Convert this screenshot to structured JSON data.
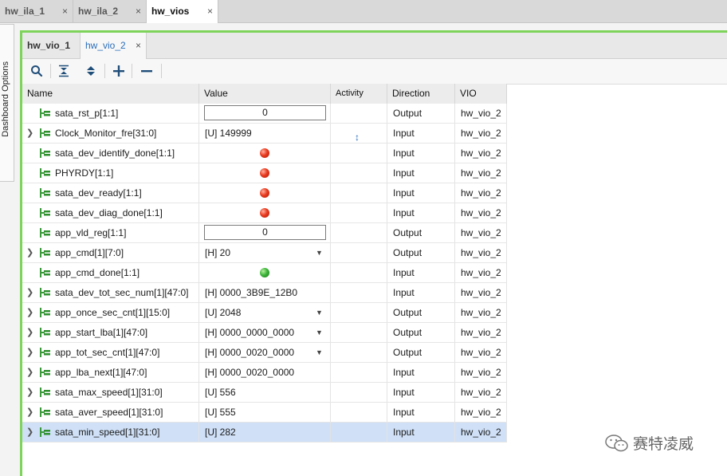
{
  "top_tabs": [
    {
      "label": "hw_ila_1",
      "close": "×",
      "active": false
    },
    {
      "label": "hw_ila_2",
      "close": "×",
      "active": false
    },
    {
      "label": "hw_vios",
      "close": "×",
      "active": true
    }
  ],
  "side_panel": {
    "label": "Dashboard Options"
  },
  "sub_tabs": [
    {
      "label": "hw_vio_1",
      "active": false
    },
    {
      "label": "hw_vio_2",
      "close": "×",
      "active": true
    }
  ],
  "toolbar": {
    "icons": [
      "search-icon",
      "collapse-all-icon",
      "expand-all-icon",
      "add-icon",
      "remove-icon"
    ]
  },
  "columns": [
    "Name",
    "Value",
    "Activity",
    "Direction",
    "VIO"
  ],
  "rows": [
    {
      "name": "sata_rst_p[1:1]",
      "expandable": false,
      "value_type": "text",
      "value": "0",
      "activity": "",
      "direction": "Output",
      "vio": "hw_vio_2"
    },
    {
      "name": "Clock_Monitor_fre[31:0]",
      "expandable": true,
      "value_type": "plain",
      "value": "[U] 149999",
      "activity": "↕",
      "direction": "Input",
      "vio": "hw_vio_2"
    },
    {
      "name": "sata_dev_identify_done[1:1]",
      "expandable": false,
      "value_type": "led",
      "led": "red",
      "activity": "",
      "direction": "Input",
      "vio": "hw_vio_2"
    },
    {
      "name": "PHYRDY[1:1]",
      "expandable": false,
      "value_type": "led",
      "led": "red",
      "activity": "",
      "direction": "Input",
      "vio": "hw_vio_2"
    },
    {
      "name": "sata_dev_ready[1:1]",
      "expandable": false,
      "value_type": "led",
      "led": "red",
      "activity": "",
      "direction": "Input",
      "vio": "hw_vio_2"
    },
    {
      "name": "sata_dev_diag_done[1:1]",
      "expandable": false,
      "value_type": "led",
      "led": "red",
      "activity": "",
      "direction": "Input",
      "vio": "hw_vio_2"
    },
    {
      "name": "app_vld_reg[1:1]",
      "expandable": false,
      "value_type": "text",
      "value": "0",
      "activity": "",
      "direction": "Output",
      "vio": "hw_vio_2"
    },
    {
      "name": "app_cmd[1][7:0]",
      "expandable": true,
      "value_type": "dropdown",
      "value": "[H] 20",
      "activity": "",
      "direction": "Output",
      "vio": "hw_vio_2"
    },
    {
      "name": "app_cmd_done[1:1]",
      "expandable": false,
      "value_type": "led",
      "led": "green",
      "activity": "",
      "direction": "Input",
      "vio": "hw_vio_2"
    },
    {
      "name": "sata_dev_tot_sec_num[1][47:0]",
      "expandable": true,
      "value_type": "plain",
      "value": "[H] 0000_3B9E_12B0",
      "activity": "",
      "direction": "Input",
      "vio": "hw_vio_2"
    },
    {
      "name": "app_once_sec_cnt[1][15:0]",
      "expandable": true,
      "value_type": "dropdown",
      "value": "[U] 2048",
      "activity": "",
      "direction": "Output",
      "vio": "hw_vio_2"
    },
    {
      "name": "app_start_lba[1][47:0]",
      "expandable": true,
      "value_type": "dropdown",
      "value": "[H] 0000_0000_0000",
      "activity": "",
      "direction": "Output",
      "vio": "hw_vio_2"
    },
    {
      "name": "app_tot_sec_cnt[1][47:0]",
      "expandable": true,
      "value_type": "dropdown",
      "value": "[H] 0000_0020_0000",
      "activity": "",
      "direction": "Output",
      "vio": "hw_vio_2"
    },
    {
      "name": "app_lba_next[1][47:0]",
      "expandable": true,
      "value_type": "plain",
      "value": "[H] 0000_0020_0000",
      "activity": "",
      "direction": "Input",
      "vio": "hw_vio_2"
    },
    {
      "name": "sata_max_speed[1][31:0]",
      "expandable": true,
      "value_type": "plain",
      "value": "[U] 556",
      "activity": "",
      "direction": "Input",
      "vio": "hw_vio_2"
    },
    {
      "name": "sata_aver_speed[1][31:0]",
      "expandable": true,
      "value_type": "plain",
      "value": "[U] 555",
      "activity": "",
      "direction": "Input",
      "vio": "hw_vio_2"
    },
    {
      "name": "sata_min_speed[1][31:0]",
      "expandable": true,
      "value_type": "plain",
      "value": "[U] 282",
      "activity": "",
      "direction": "Input",
      "vio": "hw_vio_2",
      "selected": true
    }
  ],
  "watermark": {
    "text": "赛特凌威"
  },
  "colors": {
    "accent_border": "#7ed35a",
    "selection": "#cfe0f7",
    "led_red": "#e83a1e",
    "led_green": "#3cb43a"
  }
}
